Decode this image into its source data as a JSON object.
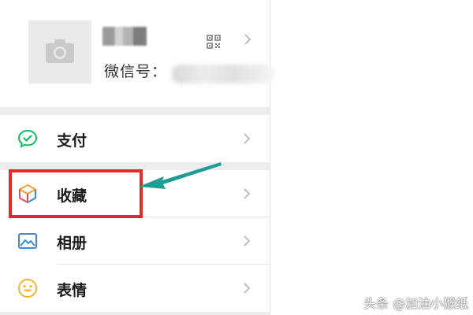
{
  "profile": {
    "wechat_id_label": "微信号：",
    "icons": {
      "avatar": "camera-icon",
      "qr": "qr-code-icon",
      "chevron": "chevron-right-icon"
    }
  },
  "menu": {
    "items": [
      {
        "label": "支付",
        "icon": "wechat-pay-icon"
      },
      {
        "label": "收藏",
        "icon": "favorites-cube-icon"
      },
      {
        "label": "相册",
        "icon": "album-icon"
      },
      {
        "label": "表情",
        "icon": "emoji-icon"
      }
    ]
  },
  "annotation": {
    "highlight_color": "#e02b2b",
    "arrow_color": "#1f9c95"
  },
  "watermark": "头条 @加油小猴纸",
  "colors": {
    "background": "#ededed",
    "pay_green": "#07c160",
    "album_blue": "#3b8bdc",
    "emoji_yellow": "#f3b52b"
  }
}
